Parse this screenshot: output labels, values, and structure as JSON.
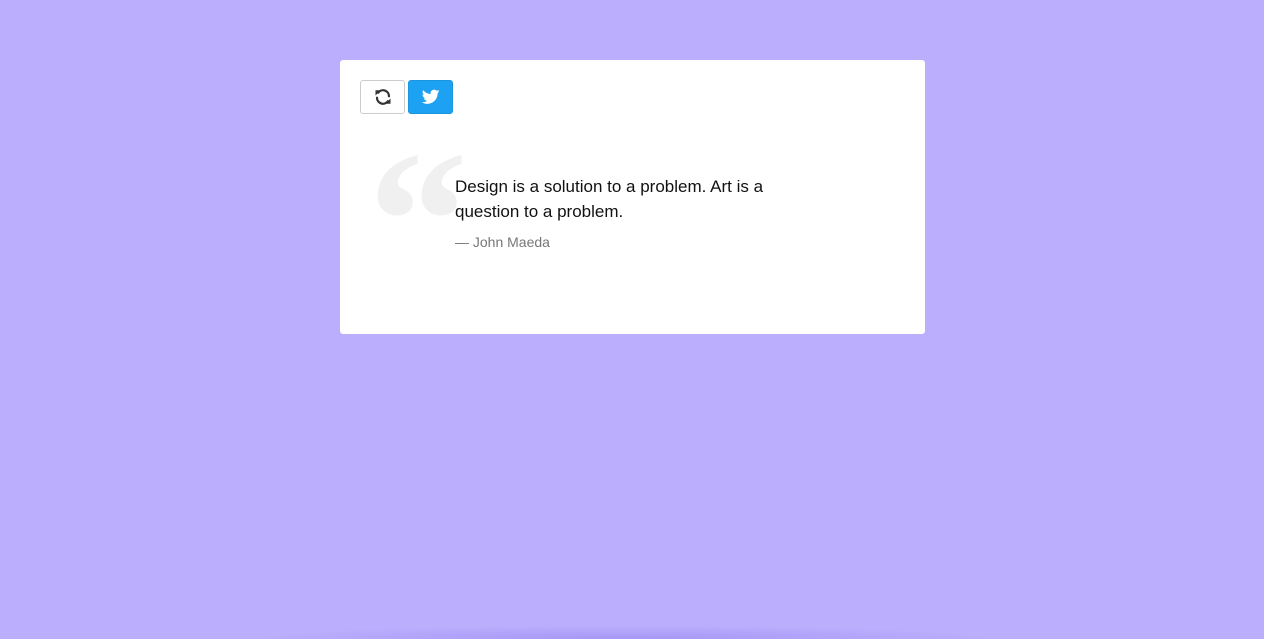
{
  "theme": {
    "background": "#bbaffd",
    "card": "#ffffff",
    "tweet_button": "#1da1f2",
    "quote_mark": "#f0f0f0"
  },
  "toolbar": {
    "refresh_icon": "refresh-icon",
    "tweet_icon": "twitter-icon"
  },
  "quote": {
    "mark": "“",
    "text": "Design is a solution to a problem. Art is a question to a problem.",
    "author": "— John Maeda"
  }
}
